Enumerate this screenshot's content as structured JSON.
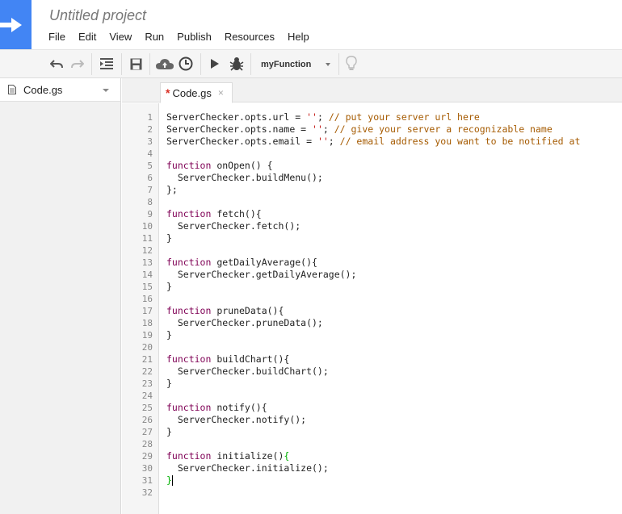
{
  "app": {
    "title": "Untitled project",
    "menu": [
      "File",
      "Edit",
      "View",
      "Run",
      "Publish",
      "Resources",
      "Help"
    ]
  },
  "toolbar": {
    "function_selector": "myFunction",
    "icons": [
      "undo-icon",
      "redo-icon",
      "indent-icon",
      "save-icon",
      "cloud-deploy-icon",
      "triggers-clock-icon",
      "run-icon",
      "debug-bug-icon",
      "lightbulb-icon"
    ]
  },
  "sidebar": {
    "files": [
      {
        "name": "Code.gs"
      }
    ]
  },
  "editor": {
    "tab": {
      "label": "Code.gs",
      "modified_marker": "*",
      "close": "×"
    },
    "lines": [
      {
        "n": "1",
        "text": "ServerChecker.opts.url = ''; // put your server url here"
      },
      {
        "n": "2",
        "text": "ServerChecker.opts.name = ''; // give your server a recognizable name"
      },
      {
        "n": "3",
        "text": "ServerChecker.opts.email = ''; // email address you want to be notified at"
      },
      {
        "n": "4",
        "text": ""
      },
      {
        "n": "5",
        "text": "function onOpen() {"
      },
      {
        "n": "6",
        "text": "  ServerChecker.buildMenu();"
      },
      {
        "n": "7",
        "text": "};"
      },
      {
        "n": "8",
        "text": ""
      },
      {
        "n": "9",
        "text": "function fetch(){"
      },
      {
        "n": "10",
        "text": "  ServerChecker.fetch();"
      },
      {
        "n": "11",
        "text": "}"
      },
      {
        "n": "12",
        "text": ""
      },
      {
        "n": "13",
        "text": "function getDailyAverage(){"
      },
      {
        "n": "14",
        "text": "  ServerChecker.getDailyAverage();"
      },
      {
        "n": "15",
        "text": "}"
      },
      {
        "n": "16",
        "text": ""
      },
      {
        "n": "17",
        "text": "function pruneData(){"
      },
      {
        "n": "18",
        "text": "  ServerChecker.pruneData();"
      },
      {
        "n": "19",
        "text": "}"
      },
      {
        "n": "20",
        "text": ""
      },
      {
        "n": "21",
        "text": "function buildChart(){"
      },
      {
        "n": "22",
        "text": "  ServerChecker.buildChart();"
      },
      {
        "n": "23",
        "text": "}"
      },
      {
        "n": "24",
        "text": ""
      },
      {
        "n": "25",
        "text": "function notify(){"
      },
      {
        "n": "26",
        "text": "  ServerChecker.notify();"
      },
      {
        "n": "27",
        "text": "}"
      },
      {
        "n": "28",
        "text": ""
      },
      {
        "n": "29",
        "text": "function initialize(){"
      },
      {
        "n": "30",
        "text": "  ServerChecker.initialize();"
      },
      {
        "n": "31",
        "text": "}"
      },
      {
        "n": "32",
        "text": ""
      }
    ]
  },
  "colors": {
    "brand": "#4285f4",
    "keyword": "#7f0055",
    "string": "#c41a16",
    "comment": "#a55a00",
    "matched_bracket": "#00b000"
  }
}
